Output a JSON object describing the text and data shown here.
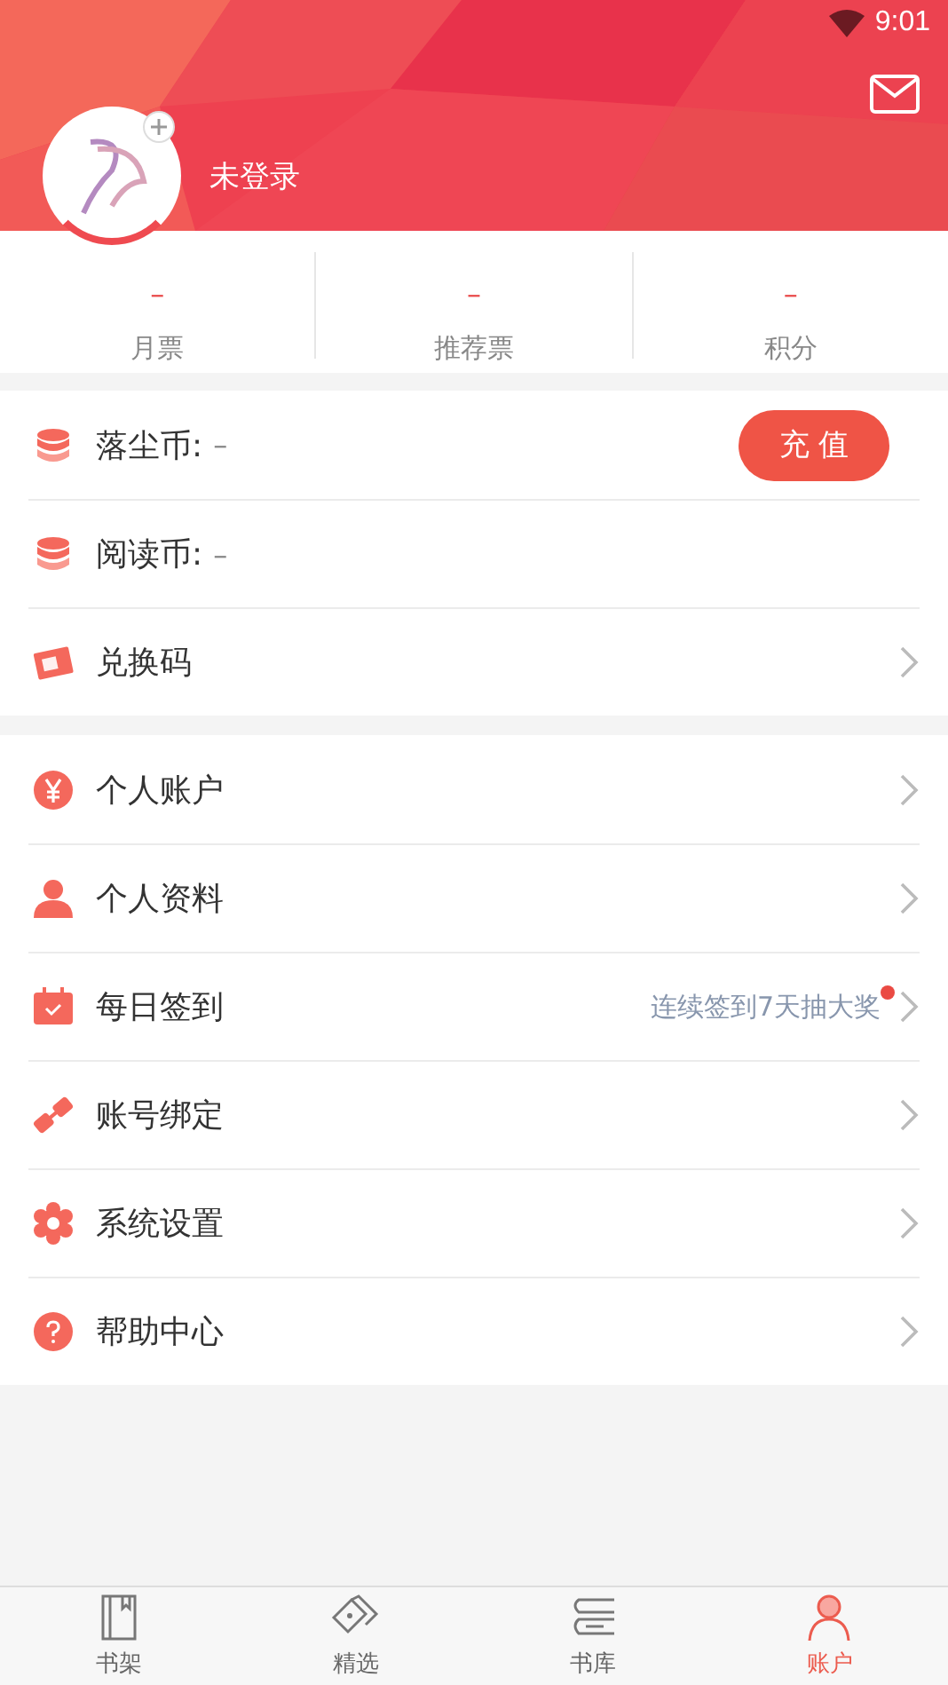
{
  "status_bar": {
    "time": "9:01"
  },
  "profile": {
    "name": "未登录"
  },
  "stats": [
    {
      "value": "–",
      "label": "月票"
    },
    {
      "value": "–",
      "label": "推荐票"
    },
    {
      "value": "–",
      "label": "积分"
    }
  ],
  "groups": [
    {
      "items": [
        {
          "label": "落尘币:",
          "value": "–",
          "button": "充 值",
          "arrow": false
        },
        {
          "label": "阅读币:",
          "value": "–",
          "arrow": false
        },
        {
          "label": "兑换码",
          "arrow": true
        }
      ]
    },
    {
      "items": [
        {
          "label": "个人账户",
          "arrow": true
        },
        {
          "label": "个人资料",
          "arrow": true
        },
        {
          "label": "每日签到",
          "hint": "连续签到7天抽大奖",
          "badge": true,
          "arrow": true
        },
        {
          "label": "账号绑定",
          "arrow": true
        },
        {
          "label": "系统设置",
          "arrow": true
        },
        {
          "label": "帮助中心",
          "arrow": true
        }
      ]
    }
  ],
  "tabs": [
    {
      "label": "书架",
      "selected": false
    },
    {
      "label": "精选",
      "selected": false
    },
    {
      "label": "书库",
      "selected": false
    },
    {
      "label": "账户",
      "selected": true
    }
  ]
}
